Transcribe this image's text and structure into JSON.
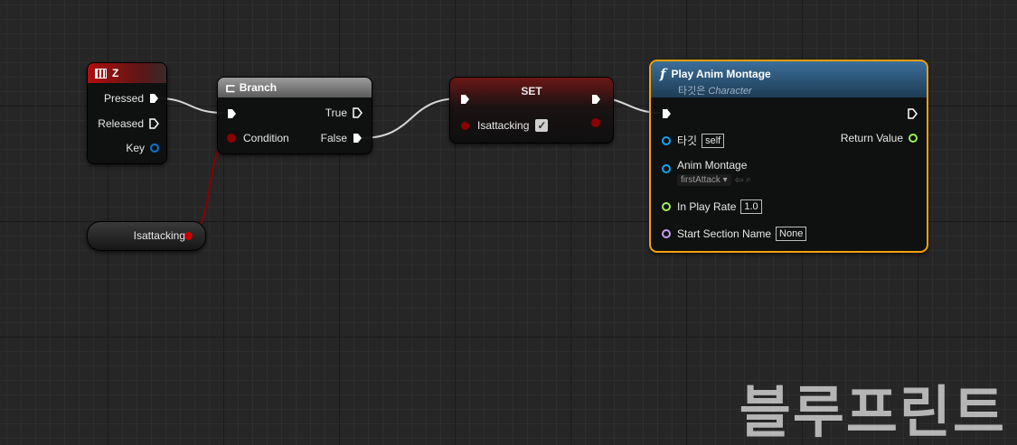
{
  "z_node": {
    "title": "Z",
    "pins": {
      "pressed": "Pressed",
      "released": "Released",
      "key": "Key"
    }
  },
  "branch_node": {
    "title": "Branch",
    "pins": {
      "condition": "Condition",
      "true": "True",
      "false": "False"
    }
  },
  "set_node": {
    "title": "SET",
    "var_label": "Isattacking",
    "checked": true
  },
  "getter_node": {
    "label": "Isattacking"
  },
  "play_node": {
    "title": "Play Anim Montage",
    "subtitle_prefix": "타깃은 ",
    "subtitle_class": "Character",
    "icon": "function-icon",
    "pins": {
      "target_label": "타깃",
      "target_value": "self",
      "return_label": "Return Value",
      "montage_label": "Anim Montage",
      "montage_value": "firstAttack",
      "rate_label": "In Play Rate",
      "rate_value": "1.0",
      "section_label": "Start Section Name",
      "section_value": "None"
    }
  },
  "watermark": "블루프린트",
  "colors": {
    "exec": "#ffffff",
    "bool": "#8c0000",
    "object": "#0ea5f5",
    "float": "#9cf152",
    "name": "#c89cf5",
    "selected_border": "#f5a00a"
  }
}
